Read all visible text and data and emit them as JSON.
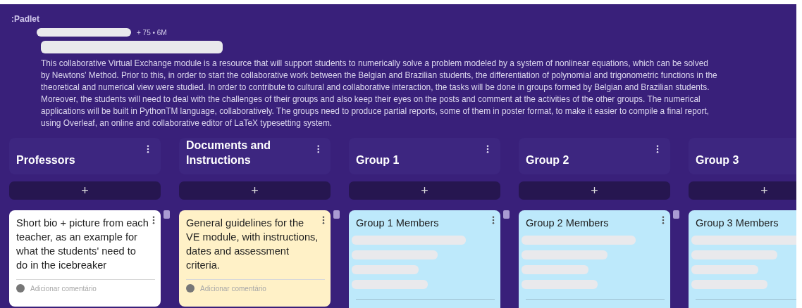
{
  "logo": ":Padlet",
  "meta": "+ 75  • 6M",
  "description": "This collaborative Virtual Exchange module is a resource that will support students to numerically solve a problem modeled by a system of nonlinear equations, which can be solved by Newtons’ Method. Prior to this, in order to start the collaborative work between the Belgian and Brazilian students, the differentiation of polynomial and trigonometric functions in the theoretical and numerical view were studied. In order to contribute to cultural and collaborative interaction, the tasks will be done in groups formed by Belgian and Brazilian students. Moreover, the students will need to deal with the challenges of their groups and also keep their eyes on the posts and comment at the activities of the other groups. The numerical applications will be built in PythonTM language, collaboratively. The groups need to produce partial reports, some of them in poster format, to make it easier to compile a final report, using Overleaf, an online and collaborative editor of LaTeX typesetting system.",
  "columns": [
    {
      "title": "Professors",
      "add_button": "+",
      "card": {
        "color": "#ffffff",
        "title": "Short bio + picture from each teacher, as an example for what the students' need to do in the icebreaker",
        "comment_placeholder": "Adicionar comentário"
      }
    },
    {
      "title": "Documents and Instructions",
      "add_button": "+",
      "card": {
        "color": "#fff1c7",
        "title": "General guidelines for the VE module, with instructions, dates and assessment criteria.",
        "comment_placeholder": "Adicionar comentário"
      }
    },
    {
      "title": "Group 1",
      "add_button": "+",
      "card": {
        "color": "#bde9fb",
        "title": "Group 1 Members"
      }
    },
    {
      "title": "Group 2",
      "add_button": "+",
      "card": {
        "color": "#bde9fb",
        "title": "Group 2 Members"
      }
    },
    {
      "title": "Group 3",
      "add_button": "+",
      "card": {
        "color": "#bde9fb",
        "title": "Group 3 Members"
      }
    }
  ]
}
